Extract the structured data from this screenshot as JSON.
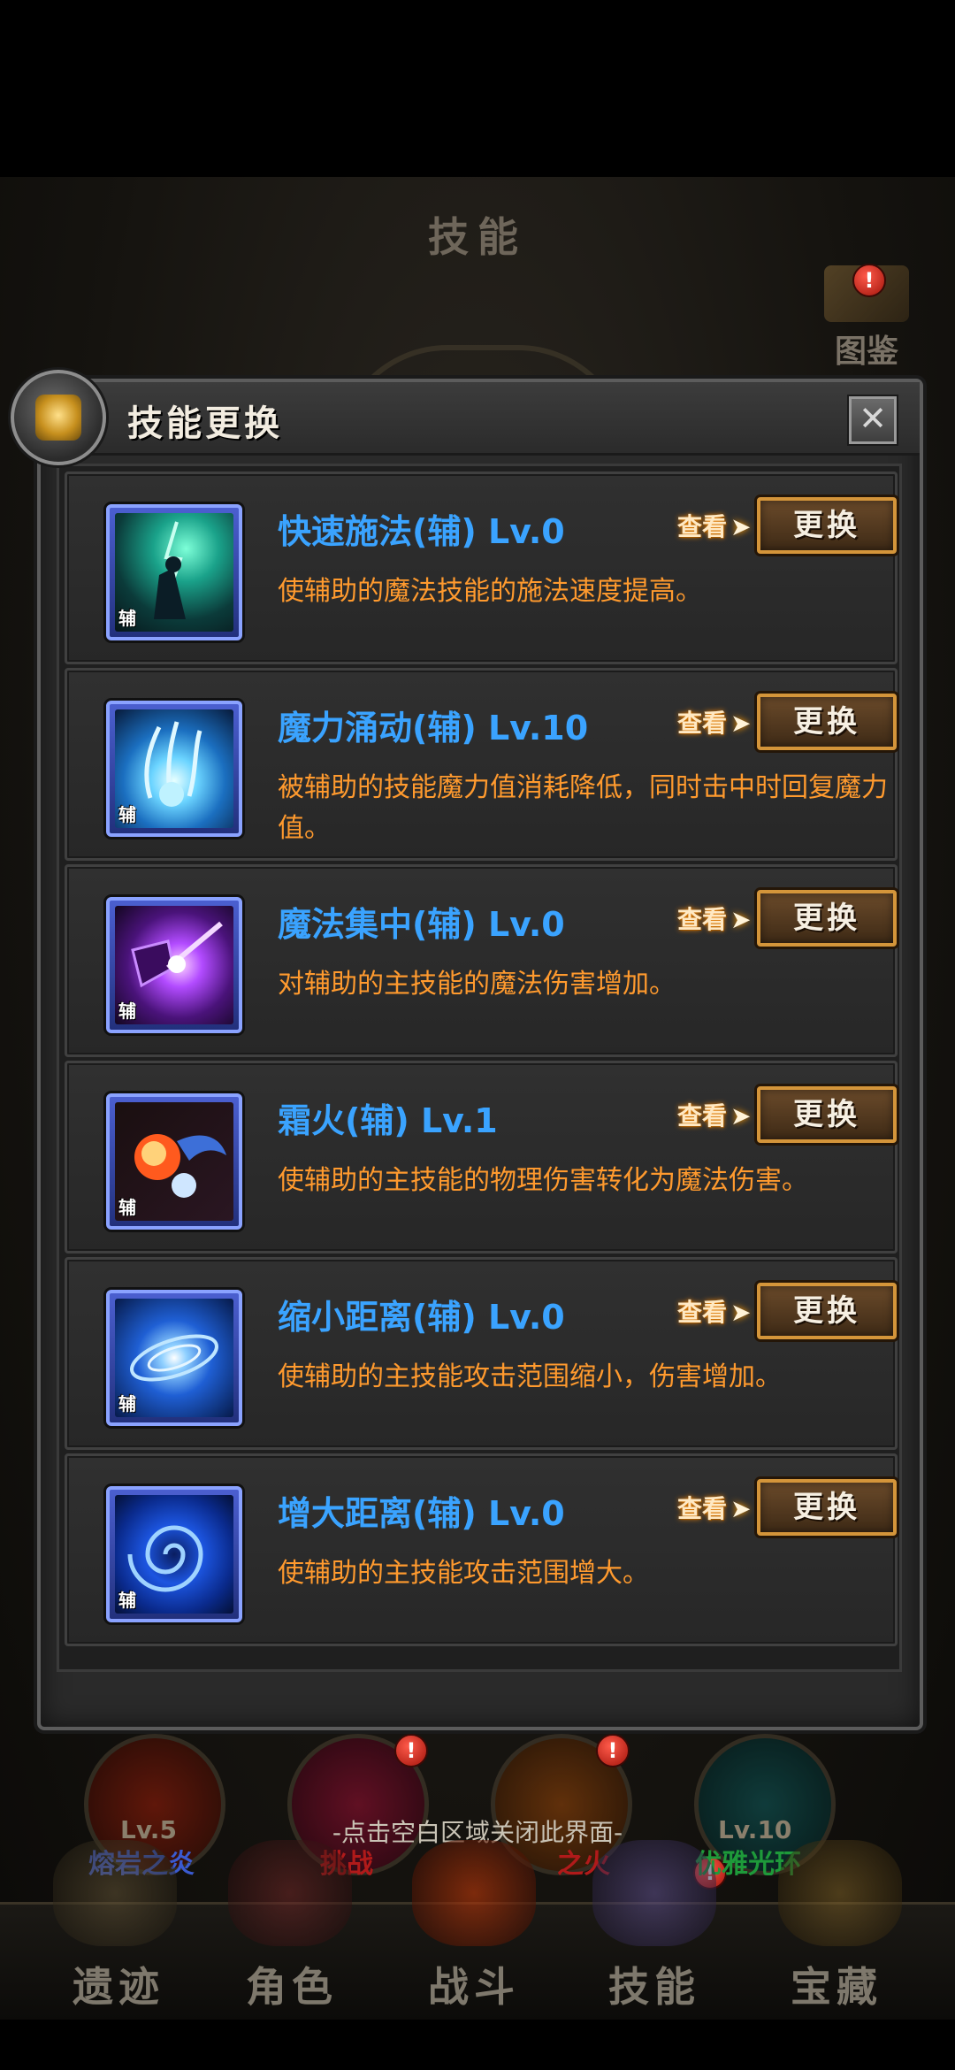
{
  "background": {
    "title": "技能",
    "book_label": "图鉴",
    "book_badge": "!",
    "levels": [
      "Lv.5",
      "Lv.10"
    ],
    "names": [
      "熔岩之炎",
      "挑战",
      "之火",
      "优雅光环"
    ]
  },
  "modal": {
    "title": "技能更换",
    "close_label": "✕",
    "view_label": "查看",
    "replace_label": "更换",
    "aux_tag": "辅",
    "skills": [
      {
        "name": "快速施法(辅) Lv.0",
        "desc": "使辅助的魔法技能的施法速度提高。",
        "icon": "lightning-caster-icon"
      },
      {
        "name": "魔力涌动(辅) Lv.10",
        "desc": "被辅助的技能魔力值消耗降低，同时击中时回复魔力值。",
        "icon": "mana-surge-icon"
      },
      {
        "name": "魔法集中(辅) Lv.0",
        "desc": "对辅助的主技能的魔法伤害增加。",
        "icon": "arcane-focus-icon"
      },
      {
        "name": "霜火(辅) Lv.1",
        "desc": "使辅助的主技能的物理伤害转化为魔法伤害。",
        "icon": "frost-fire-icon"
      },
      {
        "name": "缩小距离(辅) Lv.0",
        "desc": "使辅助的主技能攻击范围缩小，伤害增加。",
        "icon": "shrink-vortex-icon"
      },
      {
        "name": "增大距离(辅) Lv.0",
        "desc": "使辅助的主技能攻击范围增大。",
        "icon": "expand-vortex-icon"
      }
    ]
  },
  "hint": "-点击空白区域关闭此界面-",
  "tabs": [
    "遗迹",
    "角色",
    "战斗",
    "技能",
    "宝藏"
  ],
  "colors": {
    "skill_name": "#3aa3ff",
    "skill_desc": "#ff9a2e",
    "button_border": "#d4953a"
  }
}
